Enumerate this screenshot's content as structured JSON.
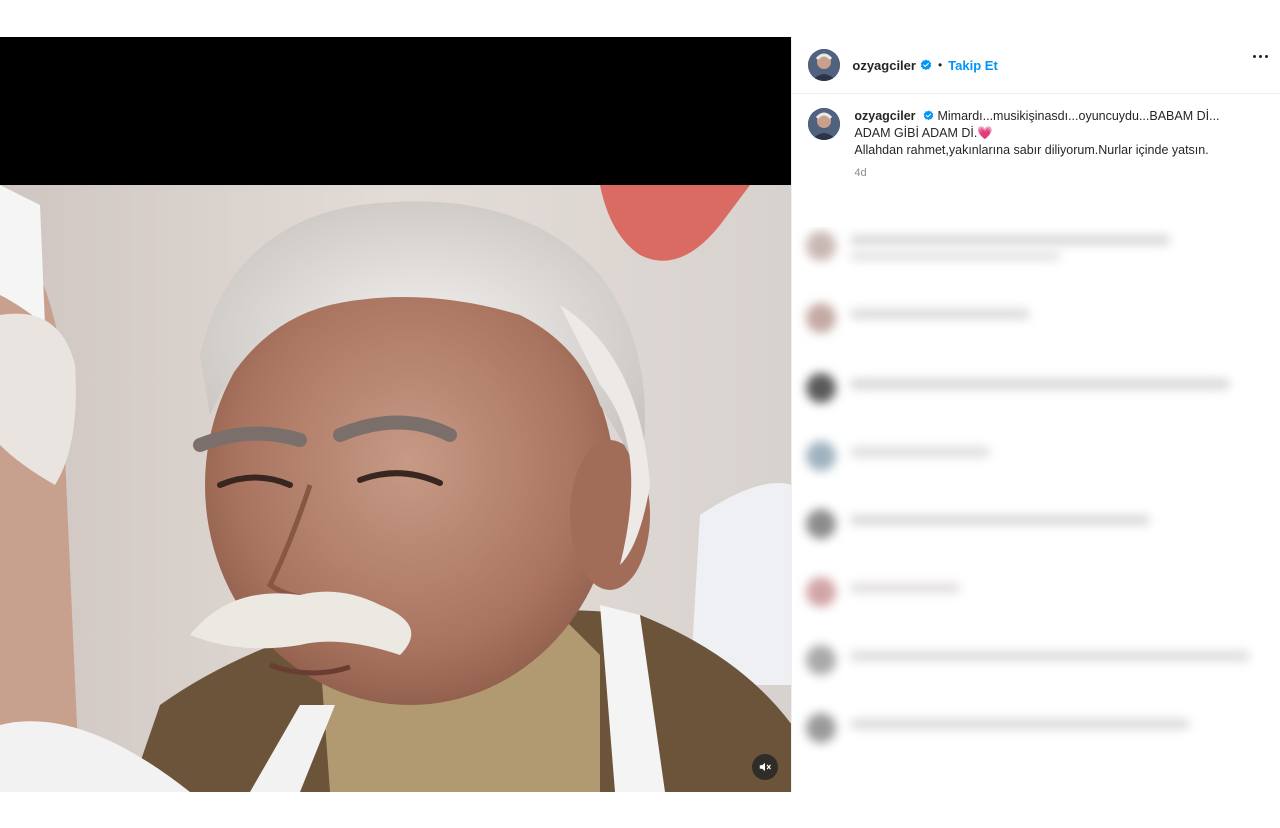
{
  "post": {
    "username": "ozyagciler",
    "follow_label": "Takip Et",
    "separator": "•",
    "caption_lines": [
      "Mimardı...musikişinasdı...oyuncuydu...BABAM Dİ...",
      "ADAM GİBİ ADAM Dİ.",
      "Allahdan rahmet,yakınlarına sabır diliyorum.Nurlar içinde yatsın."
    ],
    "heart_emoji": "💗",
    "timestamp": "4d"
  },
  "icons": {
    "verified": "verified-badge-icon",
    "more": "more-options-icon",
    "mute": "audio-muted-icon"
  },
  "colors": {
    "accent": "#0095f6",
    "verified": "#0095f6",
    "text": "#262626",
    "secondary": "#8e8e8e"
  }
}
